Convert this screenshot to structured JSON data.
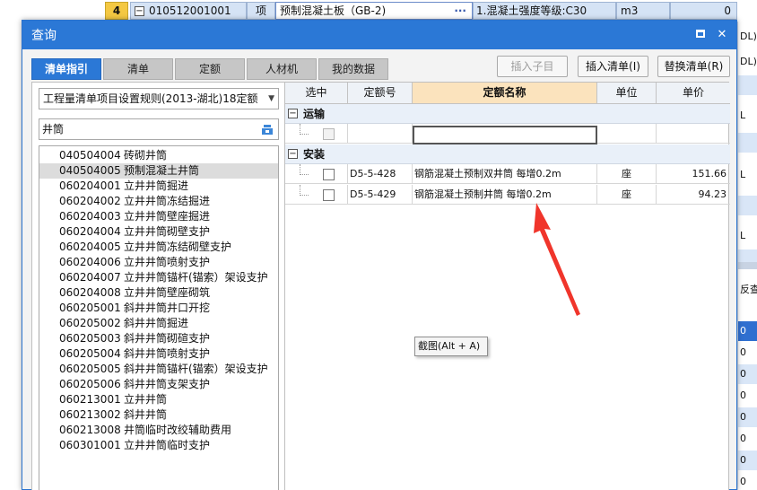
{
  "background": {
    "row_number": "4",
    "code": "010512001001",
    "type": "项",
    "name": "预制混凝土板（GB-2)",
    "name_button": "···",
    "feature": "1.混凝土强度等级:C30",
    "unit": "m3",
    "quantity": "0",
    "right_col": [
      "DL)*",
      "DL)*",
      "",
      "L",
      "",
      "L",
      "",
      "L",
      "",
      "",
      "",
      "反查[",
      "0",
      "0",
      "0",
      "0",
      "0",
      "0",
      "0",
      "0"
    ]
  },
  "dialog": {
    "title": "查询",
    "tabs": [
      {
        "label": "清单指引",
        "active": true
      },
      {
        "label": "清单",
        "active": false
      },
      {
        "label": "定额",
        "active": false
      },
      {
        "label": "人材机",
        "active": false
      },
      {
        "label": "我的数据",
        "active": false
      }
    ],
    "buttons": {
      "insert_child": "插入子目",
      "insert_list": "插入清单(I)",
      "replace_list": "替换清单(R)"
    },
    "rule_select": "工程量清单项目设置规则(2013-湖北)18定额",
    "search_value": "井筒",
    "list": [
      {
        "code": "040504004",
        "name": "砖砌井筒"
      },
      {
        "code": "040504005",
        "name": "预制混凝土井筒"
      },
      {
        "code": "060204001",
        "name": "立井井筒掘进"
      },
      {
        "code": "060204002",
        "name": "立井井筒冻结掘进"
      },
      {
        "code": "060204003",
        "name": "立井井筒壁座掘进"
      },
      {
        "code": "060204004",
        "name": "立井井筒砌壁支护"
      },
      {
        "code": "060204005",
        "name": "立井井筒冻结砌壁支护"
      },
      {
        "code": "060204006",
        "name": "立井井筒喷射支护"
      },
      {
        "code": "060204007",
        "name": "立井井筒锚杆(锚索）架设支护"
      },
      {
        "code": "060204008",
        "name": "立井井筒壁座砌筑"
      },
      {
        "code": "060205001",
        "name": "斜井井筒井口开挖"
      },
      {
        "code": "060205002",
        "name": "斜井井筒掘进"
      },
      {
        "code": "060205003",
        "name": "斜井井筒砌碹支护"
      },
      {
        "code": "060205004",
        "name": "斜井井筒喷射支护"
      },
      {
        "code": "060205005",
        "name": "斜井井筒锚杆(锚索）架设支护"
      },
      {
        "code": "060205006",
        "name": "斜井井筒支架支护"
      },
      {
        "code": "060213001",
        "name": "立井井筒"
      },
      {
        "code": "060213002",
        "name": "斜井井筒"
      },
      {
        "code": "060213008",
        "name": "井筒临时改绞辅助费用"
      },
      {
        "code": "060301001",
        "name": "立井井筒临时支护"
      }
    ],
    "selected_list_index": 1,
    "grid": {
      "headers": [
        "选中",
        "定额号",
        "定额名称",
        "单位",
        "单价"
      ],
      "groups": [
        {
          "toggle": "−",
          "label": "运输",
          "rows": []
        },
        {
          "toggle": "−",
          "label": "安装",
          "rows": [
            {
              "code": "D5-5-428",
              "name": "钢筋混凝土预制双井筒 每增0.2m",
              "unit": "座",
              "price": "151.66"
            },
            {
              "code": "D5-5-429",
              "name": "钢筋混凝土预制井筒 每增0.2m",
              "unit": "座",
              "price": "94.23"
            }
          ]
        }
      ]
    }
  },
  "tooltip": "截图(Alt + A)",
  "colors": {
    "accent": "#2b78d6",
    "annotation_arrow": "#f0352b",
    "header_highlight": "#fbe3bd"
  }
}
